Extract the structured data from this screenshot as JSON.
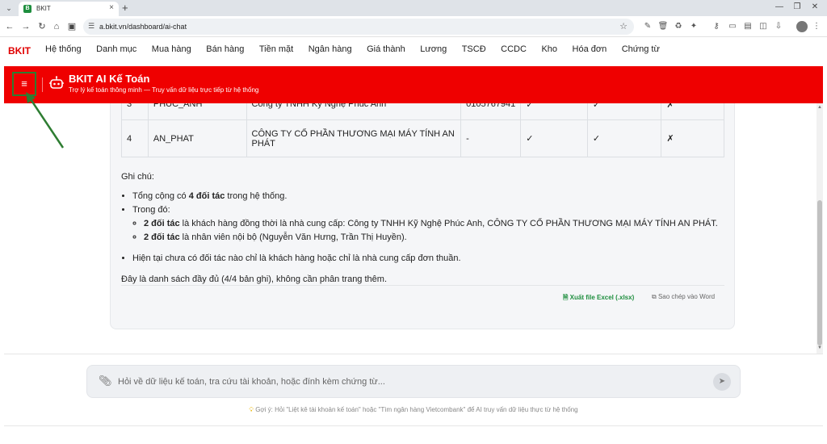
{
  "browser": {
    "tab_title": "BKIT",
    "tab_favicon_letter": "B",
    "url": "a.bkit.vn/dashboard/ai-chat"
  },
  "app": {
    "brand": "BKIT",
    "menu": [
      "Hệ thống",
      "Danh mục",
      "Mua hàng",
      "Bán hàng",
      "Tiền mặt",
      "Ngân hàng",
      "Giá thành",
      "Lương",
      "TSCĐ",
      "CCDC",
      "Kho",
      "Hóa đơn",
      "Chứng từ"
    ]
  },
  "header": {
    "menu_glyph": "≡",
    "title": "BKIT AI Kế Toán",
    "subtitle": "Trợ lý kế toán thông minh — Truy vấn dữ liệu trực tiếp từ hệ thống",
    "accent_color": "#ef0000"
  },
  "table": {
    "rows": [
      {
        "no": "3",
        "code": "PHUC_ANH",
        "name": "Công ty TNHH Kỹ Nghệ Phúc Anh",
        "tax": "0105767941",
        "c1": "✓",
        "c2": "✓",
        "c3": "✗"
      },
      {
        "no": "4",
        "code": "AN_PHAT",
        "name": "CÔNG TY CỔ PHẦN THƯƠNG MẠI MÁY TÍNH AN PHÁT",
        "tax": "-",
        "c1": "✓",
        "c2": "✓",
        "c3": "✗"
      }
    ]
  },
  "notes": {
    "label": "Ghi chú:",
    "total_pre": "Tổng cộng có ",
    "total_bold": "4 đối tác",
    "total_post": " trong hệ thống.",
    "among": "Trong đó:",
    "sub1_bold": "2 đối tác",
    "sub1_text": " là khách hàng đồng thời là nhà cung cấp: Công ty TNHH Kỹ Nghệ Phúc Anh, CÔNG TY CỔ PHẦN THƯƠNG MẠI MÁY TÍNH AN PHÁT.",
    "sub2_bold": "2 đối tác",
    "sub2_text": " là nhân viên nội bộ (Nguyễn Văn Hưng, Trần Thị Huyền).",
    "none_pure": "Hiện tại chưa có đối tác nào chỉ là khách hàng hoặc chỉ là nhà cung cấp đơn thuần.",
    "summary": "Đây là danh sách đầy đủ (4/4 bản ghi), không cần phân trang thêm."
  },
  "actions": {
    "export_excel": "Xuất file Excel (.xlsx)",
    "copy_word": "Sao chép vào Word"
  },
  "composer": {
    "placeholder": "Hỏi về dữ liệu kế toán, tra cứu tài khoản, hoặc đính kèm chứng từ...",
    "hint": "Gợi ý: Hỏi \"Liệt kê tài khoản kế toán\" hoặc \"Tìm ngân hàng Vietcombank\" để AI truy vấn dữ liệu thực từ hệ thống"
  }
}
